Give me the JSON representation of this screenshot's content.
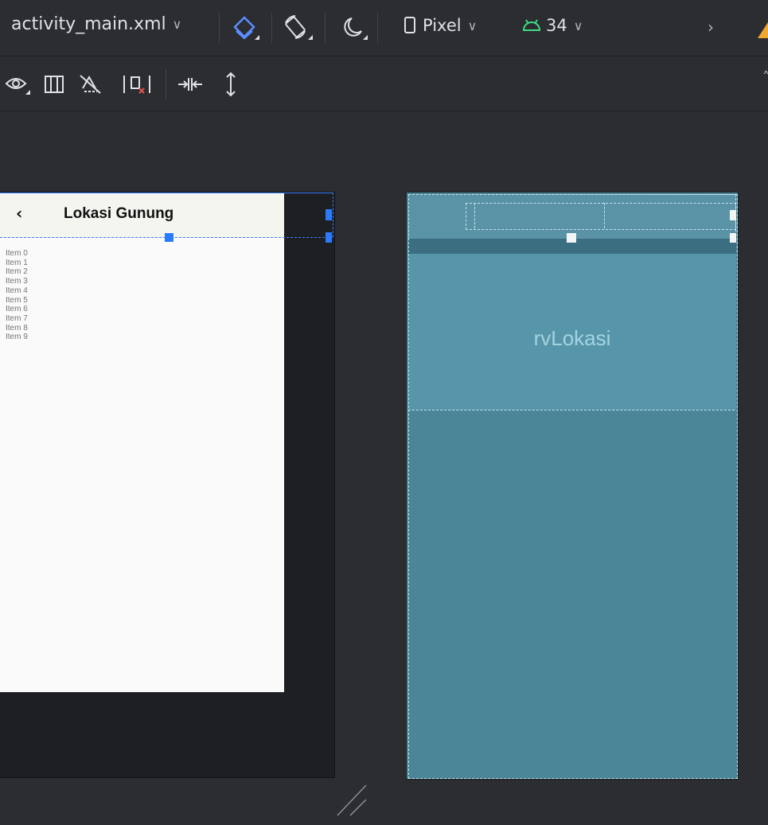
{
  "toolbar": {
    "file_name": "activity_main.xml",
    "device": "Pixel",
    "api_level": "34"
  },
  "preview": {
    "app_title": "Lokasi Gunung",
    "list_items": [
      "Item 0",
      "Item 1",
      "Item 2",
      "Item 3",
      "Item 4",
      "Item 5",
      "Item 6",
      "Item 7",
      "Item 8",
      "Item 9"
    ]
  },
  "blueprint": {
    "rv_label": "rvLokasi"
  },
  "colors": {
    "selection": "#2b7bff",
    "blueprint_bg": "#4b8598",
    "accent_android": "#3ddc84",
    "warning": "#f0a732"
  }
}
